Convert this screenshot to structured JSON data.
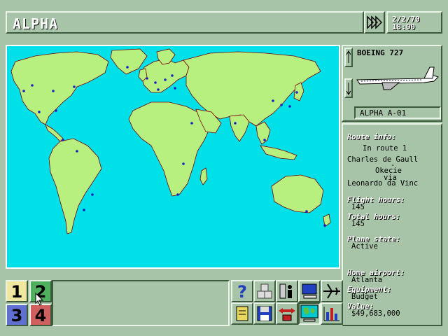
{
  "header": {
    "title": "ALPHA",
    "date": "2/2/70",
    "time": "18:00"
  },
  "plane": {
    "model": "BOEING 727",
    "id": "ALPHA A-01"
  },
  "route": {
    "label": "Route info:",
    "status": "In route 1",
    "origin": "Charles de Gaull",
    "dash": "-",
    "destination": "Okecie",
    "via_label": "via",
    "via": "Leonardo da Vinc"
  },
  "stats": {
    "flight_hours_label": "Flight hours:",
    "flight_hours": "145",
    "total_hours_label": "Total hours:",
    "total_hours": "145",
    "state_label": "Plane state:",
    "state": "Active",
    "home_label": "Home airport:",
    "home": "Atlanta",
    "equipment_label": "Equipment:",
    "equipment": "Budget",
    "value_label": "Value:",
    "value": "$49,683,000"
  },
  "slots": [
    {
      "label": "1",
      "color": "#f0e8a0"
    },
    {
      "label": "2",
      "color": "#50b060"
    },
    {
      "label": "3",
      "color": "#6070d0"
    },
    {
      "label": "4",
      "color": "#d06060"
    }
  ],
  "map_colors": {
    "ocean": "#00e0e8",
    "land": "#b8f080",
    "border": "#a02020",
    "airport": "#2020c0"
  },
  "tools": [
    "help-icon",
    "crates-icon",
    "office-icon",
    "computer-icon",
    "plane-icon",
    "document-icon",
    "save-disk-icon",
    "route-arrows-icon",
    "globe-icon",
    "bar-chart-icon"
  ]
}
